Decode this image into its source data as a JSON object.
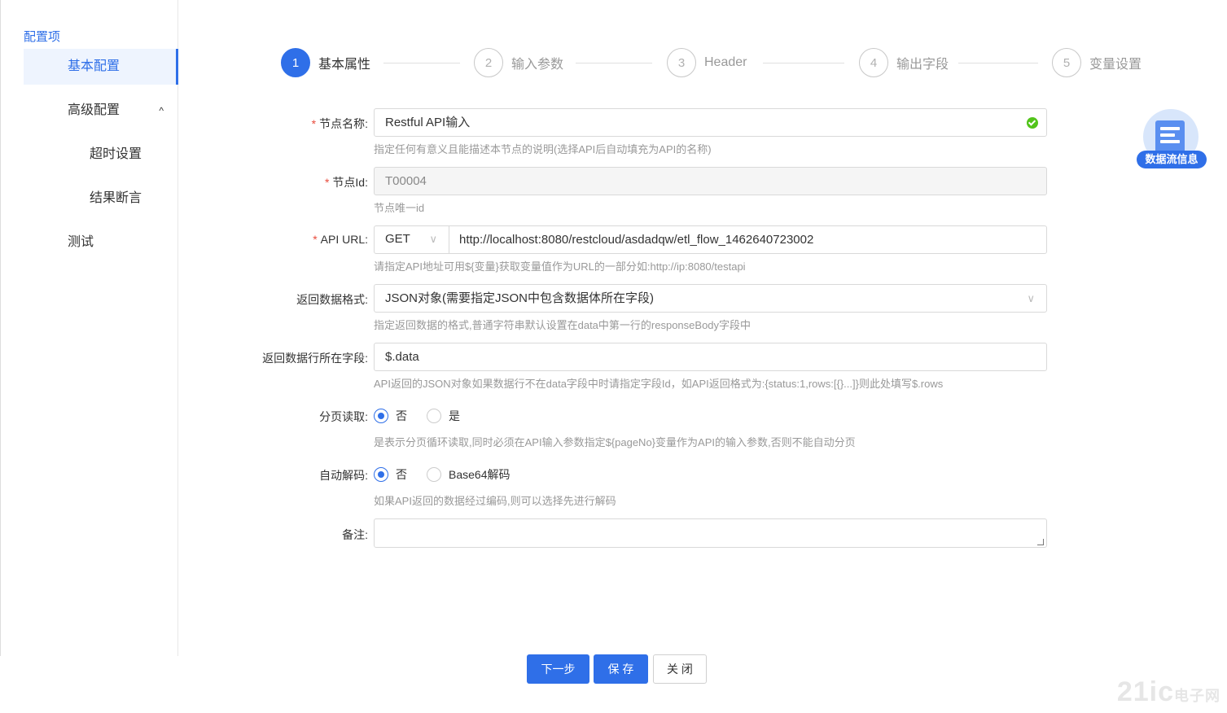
{
  "sidebar": {
    "title": "配置项",
    "items": [
      {
        "label": "基本配置"
      },
      {
        "label": "高级配置",
        "chevron": "^"
      },
      {
        "label": "超时设置"
      },
      {
        "label": "结果断言"
      },
      {
        "label": "测试"
      }
    ]
  },
  "steps": [
    {
      "num": "1",
      "label": "基本属性",
      "active": true
    },
    {
      "num": "2",
      "label": "输入参数"
    },
    {
      "num": "3",
      "label": "Header"
    },
    {
      "num": "4",
      "label": "输出字段"
    },
    {
      "num": "5",
      "label": "变量设置"
    }
  ],
  "form": {
    "node_name": {
      "label": "节点名称:",
      "value": "Restful API输入",
      "help": "指定任何有意义且能描述本节点的说明(选择API后自动填充为API的名称)"
    },
    "node_id": {
      "label": "节点Id:",
      "value": "T00004",
      "help": "节点唯一id"
    },
    "api_url": {
      "label": "API URL:",
      "method": "GET",
      "value": "http://localhost:8080/restcloud/asdadqw/etl_flow_1462640723002",
      "help": "请指定API地址可用${变量}获取变量值作为URL的一部分如:http://ip:8080/testapi"
    },
    "return_format": {
      "label": "返回数据格式:",
      "value": "JSON对象(需要指定JSON中包含数据体所在字段)",
      "help": "指定返回数据的格式,普通字符串默认设置在data中第一行的responseBody字段中"
    },
    "row_field": {
      "label": "返回数据行所在字段:",
      "value": "$.data",
      "help": "API返回的JSON对象如果数据行不在data字段中时请指定字段Id，如API返回格式为:{status:1,rows:[{}...]}则此处填写$.rows"
    },
    "paging": {
      "label": "分页读取:",
      "options": [
        "否",
        "是"
      ],
      "selected": "否",
      "help": "是表示分页循环读取,同时必须在API输入参数指定${pageNo}变量作为API的输入参数,否则不能自动分页"
    },
    "decode": {
      "label": "自动解码:",
      "options": [
        "否",
        "Base64解码"
      ],
      "selected": "否",
      "help": "如果API返回的数据经过编码,则可以选择先进行解码"
    },
    "remark": {
      "label": "备注:",
      "value": ""
    }
  },
  "float_badge": {
    "label": "数据流信息",
    "icon": "document-icon"
  },
  "buttons": {
    "next": "下一步",
    "save": "保 存",
    "close": "关 闭"
  },
  "watermark": {
    "text": "21ic",
    "sub": "电子网"
  },
  "colors": {
    "accent": "#2f6fe8",
    "success": "#52c41a",
    "required": "#e84c3d"
  }
}
